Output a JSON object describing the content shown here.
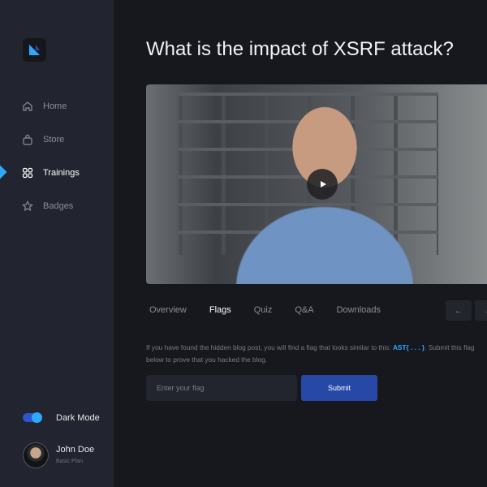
{
  "sidebar": {
    "items": [
      {
        "label": "Home"
      },
      {
        "label": "Store"
      },
      {
        "label": "Trainings"
      },
      {
        "label": "Badges"
      }
    ],
    "dark_mode_label": "Dark Mode",
    "dark_mode_on": true,
    "user": {
      "name": "John Doe",
      "plan": "Basic Plan"
    }
  },
  "main": {
    "title": "What is the impact of XSRF attack?",
    "tabs": [
      "Overview",
      "Flags",
      "Quiz",
      "Q&A",
      "Downloads"
    ],
    "active_tab": "Flags",
    "prev_icon": "←",
    "next_icon": "→",
    "desc_pre": "If you have found the hidden blog post, you will find a flag that looks similar to this: ",
    "flag_example": "AST{ . . . }",
    "desc_post": ". Submit this flag below to prove that you hacked the blog.",
    "input_placeholder": "Enter your flag",
    "submit_label": "Submit"
  },
  "colors": {
    "accent": "#2fa8ff",
    "button": "#2848a8"
  }
}
